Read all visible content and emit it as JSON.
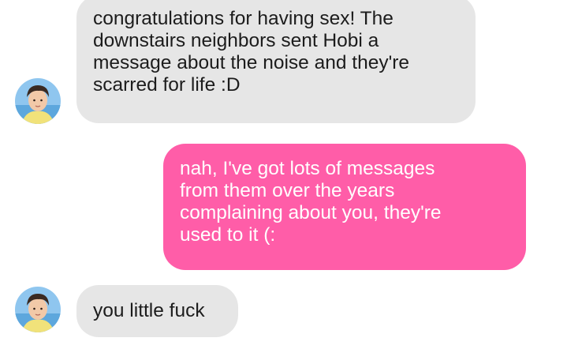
{
  "conversation": {
    "messages": [
      {
        "sender": "them",
        "text": "congratulations for having sex! The\ndownstairs neighbors sent Hobi a\nmessage about the noise and they're\nscarred for life :D"
      },
      {
        "sender": "me",
        "text": "nah, I've got lots of messages\nfrom them over the years\ncomplaining about you, they're\nused to it (:"
      },
      {
        "sender": "them",
        "text": "you little fuck"
      }
    ]
  },
  "colors": {
    "incoming_bubble": "#e6e6e6",
    "outgoing_bubble": "#ff5da8",
    "incoming_text": "#1c1c1c",
    "outgoing_text": "#ffffff"
  }
}
